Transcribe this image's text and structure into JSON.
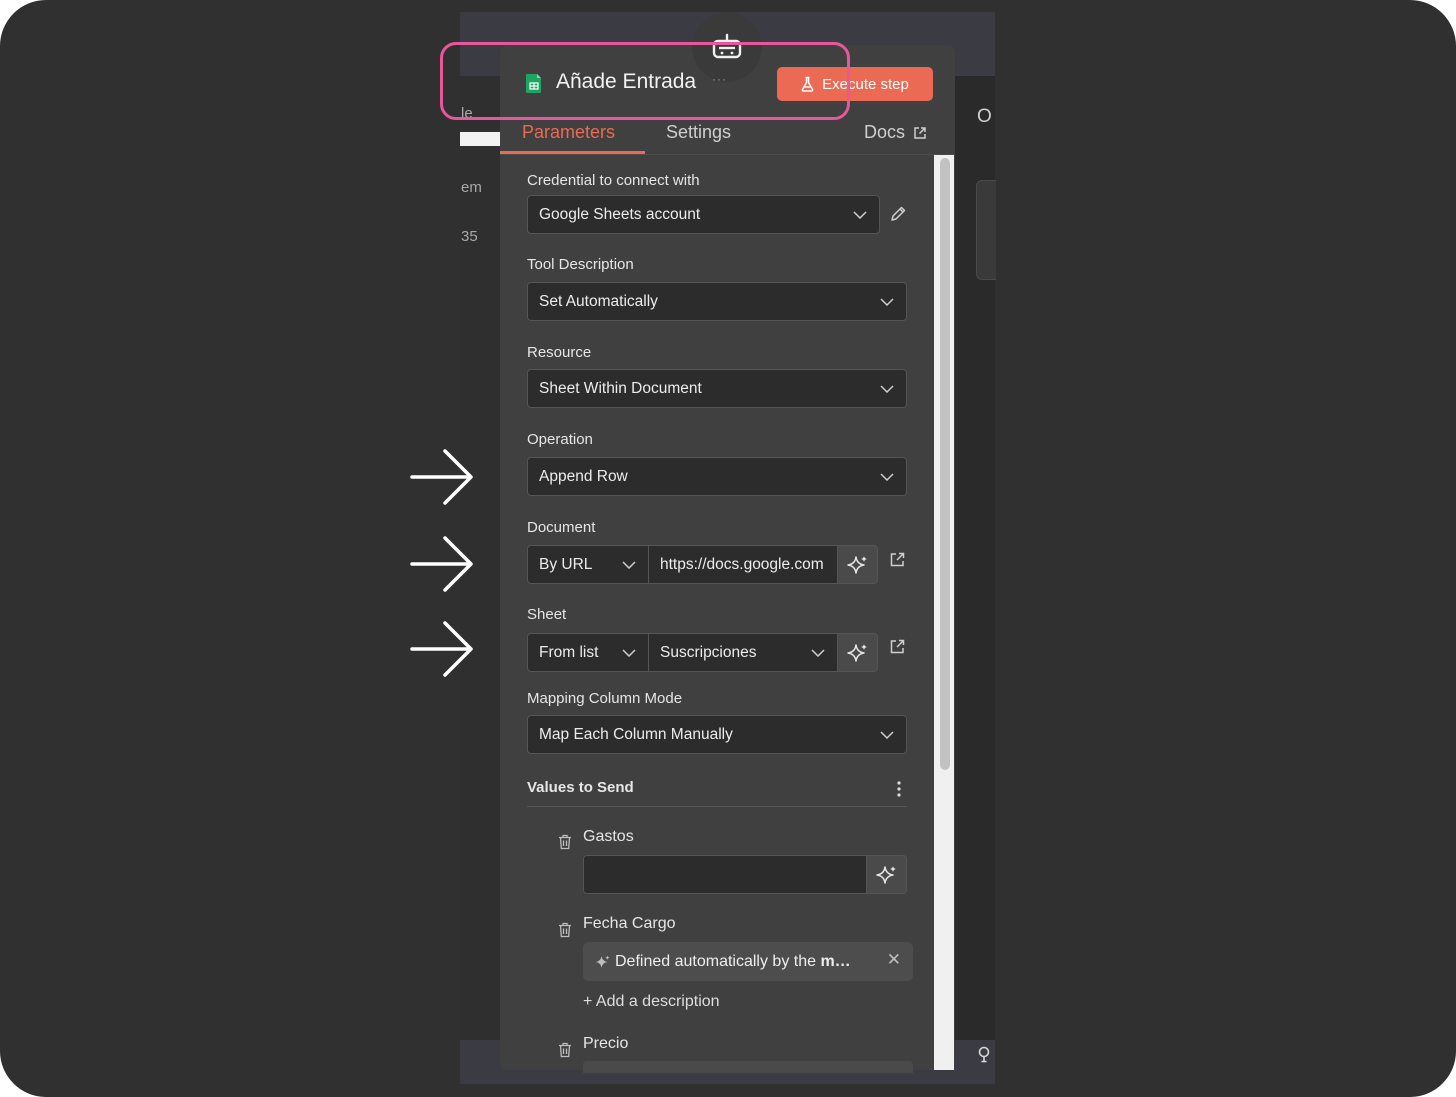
{
  "header": {
    "title": "Añade Entrada",
    "more": "···",
    "execute_label": "Execute step"
  },
  "tabs": {
    "parameters": "Parameters",
    "settings": "Settings",
    "docs": "Docs"
  },
  "background": {
    "frag_top": "le",
    "frag_em": "em",
    "frag_num": "35",
    "frag_right": "O"
  },
  "fields": {
    "credential": {
      "label": "Credential to connect with",
      "value": "Google Sheets account"
    },
    "tool_description": {
      "label": "Tool Description",
      "value": "Set Automatically"
    },
    "resource": {
      "label": "Resource",
      "value": "Sheet Within Document"
    },
    "operation": {
      "label": "Operation",
      "value": "Append Row"
    },
    "document": {
      "label": "Document",
      "mode": "By URL",
      "value": "https://docs.google.com"
    },
    "sheet": {
      "label": "Sheet",
      "mode": "From list",
      "value": "Suscripciones"
    },
    "mapping": {
      "label": "Mapping Column Mode",
      "value": "Map Each Column Manually"
    }
  },
  "values_to_send": {
    "label": "Values to Send",
    "items": [
      {
        "name": "Gastos"
      },
      {
        "name": "Fecha Cargo",
        "chip_prefix": "Defined automatically by the ",
        "chip_bold": "m…",
        "add_description": "+ Add a description"
      },
      {
        "name": "Precio"
      }
    ]
  },
  "colors": {
    "accent": "#ea6a53",
    "highlight": "#e8579c",
    "panel": "#404040",
    "input_bg": "#2c2c2c"
  }
}
